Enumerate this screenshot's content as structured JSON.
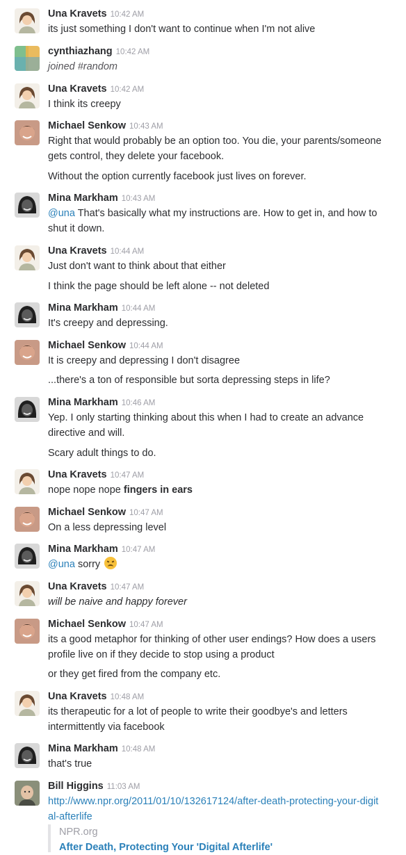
{
  "colors": {
    "link": "#2a80b9",
    "timestamp": "#9e9ea6",
    "text": "#2c2d30"
  },
  "messages": [
    {
      "user": "Una Kravets",
      "avatar": "una-avatar",
      "time": "10:42 AM",
      "lines": [
        "its just something I don't want to continue when I'm not alive"
      ]
    },
    {
      "user": "cynthiazhang",
      "avatar": "cynthia-avatar",
      "time": "10:42 AM",
      "lines": [
        "joined #random"
      ]
    },
    {
      "user": "Una Kravets",
      "avatar": "una-avatar",
      "time": "10:42 AM",
      "lines": [
        "I think its creepy"
      ]
    },
    {
      "user": "Michael Senkow",
      "avatar": "michael-avatar",
      "time": "10:43 AM",
      "lines": [
        "Right that would probably be an option too. You die, your parents/someone gets control, they delete your facebook.",
        "Without the option currently facebook just lives on forever."
      ]
    },
    {
      "user": "Mina Markham",
      "avatar": "mina-avatar",
      "time": "10:43 AM",
      "mention": "@una",
      "lines": [
        "That's basically what my instructions are. How to get in, and how to shut it down."
      ]
    },
    {
      "user": "Una Kravets",
      "avatar": "una-avatar",
      "time": "10:44 AM",
      "lines": [
        "Just don't want to think about that either",
        "I think the page should be left alone -- not deleted"
      ]
    },
    {
      "user": "Mina Markham",
      "avatar": "mina-avatar",
      "time": "10:44 AM",
      "lines": [
        "It's creepy and depressing."
      ]
    },
    {
      "user": "Michael Senkow",
      "avatar": "michael-avatar",
      "time": "10:44 AM",
      "lines": [
        "It is creepy and depressing I don't disagree",
        "...there's a ton of responsible but sorta depressing steps in life?"
      ]
    },
    {
      "user": "Mina Markham",
      "avatar": "mina-avatar",
      "time": "10:46 AM",
      "lines": [
        "Yep. I only starting thinking about this when I had to create an advance directive and will.",
        "Scary adult things to do."
      ]
    },
    {
      "user": "Una Kravets",
      "avatar": "una-avatar",
      "time": "10:47 AM",
      "lines": [
        "nope nope nope"
      ],
      "bold_suffix": "fingers in ears"
    },
    {
      "user": "Michael Senkow",
      "avatar": "michael-avatar",
      "time": "10:47 AM",
      "lines": [
        "On a less depressing level"
      ]
    },
    {
      "user": "Mina Markham",
      "avatar": "mina-avatar",
      "time": "10:47 AM",
      "mention": "@una",
      "lines": [
        "sorry"
      ],
      "emoji": "disappointed-emoji"
    },
    {
      "user": "Una Kravets",
      "avatar": "una-avatar",
      "time": "10:47 AM",
      "lines": [
        "will be naive and happy forever"
      ]
    },
    {
      "user": "Michael Senkow",
      "avatar": "michael-avatar",
      "time": "10:47 AM",
      "lines": [
        "its a good metaphor for thinking of other user endings? How does a users profile live on if they decide to stop using a product",
        "or they get fired from the company etc."
      ]
    },
    {
      "user": "Una Kravets",
      "avatar": "una-avatar",
      "time": "10:48 AM",
      "lines": [
        "its therapeutic for a lot of people to write their goodbye's and letters intermittently via facebook"
      ]
    },
    {
      "user": "Mina Markham",
      "avatar": "mina-avatar",
      "time": "10:48 AM",
      "lines": [
        "that's true"
      ]
    },
    {
      "user": "Bill Higgins",
      "avatar": "bill-avatar",
      "time": "11:03 AM",
      "lines": [
        "http://www.npr.org/2011/01/10/132617124/after-death-protecting-your-digital-afterlife"
      ],
      "attachment": {
        "source": "NPR.org",
        "title": "After Death, Protecting Your 'Digital Afterlife'"
      }
    }
  ]
}
